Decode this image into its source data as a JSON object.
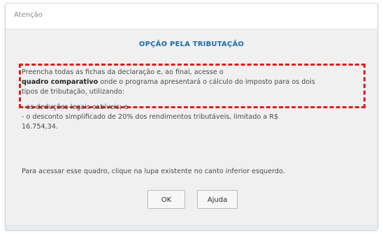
{
  "dialog": {
    "title": "Atenção",
    "heading": "OPÇÃO PELA TRIBUTAÇÃO",
    "paragraph1": {
      "line1": "Preencha todas as fichas da declaração e, ao final, acesse o",
      "line2_bold": "quadro comparativo",
      "line2_rest": " onde o programa apresentará o cálculo do imposto para os dois",
      "line3": "tipos de tributação, utilizando:"
    },
    "paragraph2": {
      "line1": "- as deduções legais cabíveis; e",
      "line2": "- o desconto simplificado de 20% dos rendimentos tributáveis, limitado a R$",
      "line3": "16.754,34."
    },
    "paragraph3": "Para acessar esse quadro, clique na lupa existente no canto inferior esquerdo.",
    "buttons": {
      "ok": "OK",
      "help": "Ajuda"
    }
  },
  "colors": {
    "heading": "#1f6fa8",
    "highlight_border": "#e31b1b"
  }
}
